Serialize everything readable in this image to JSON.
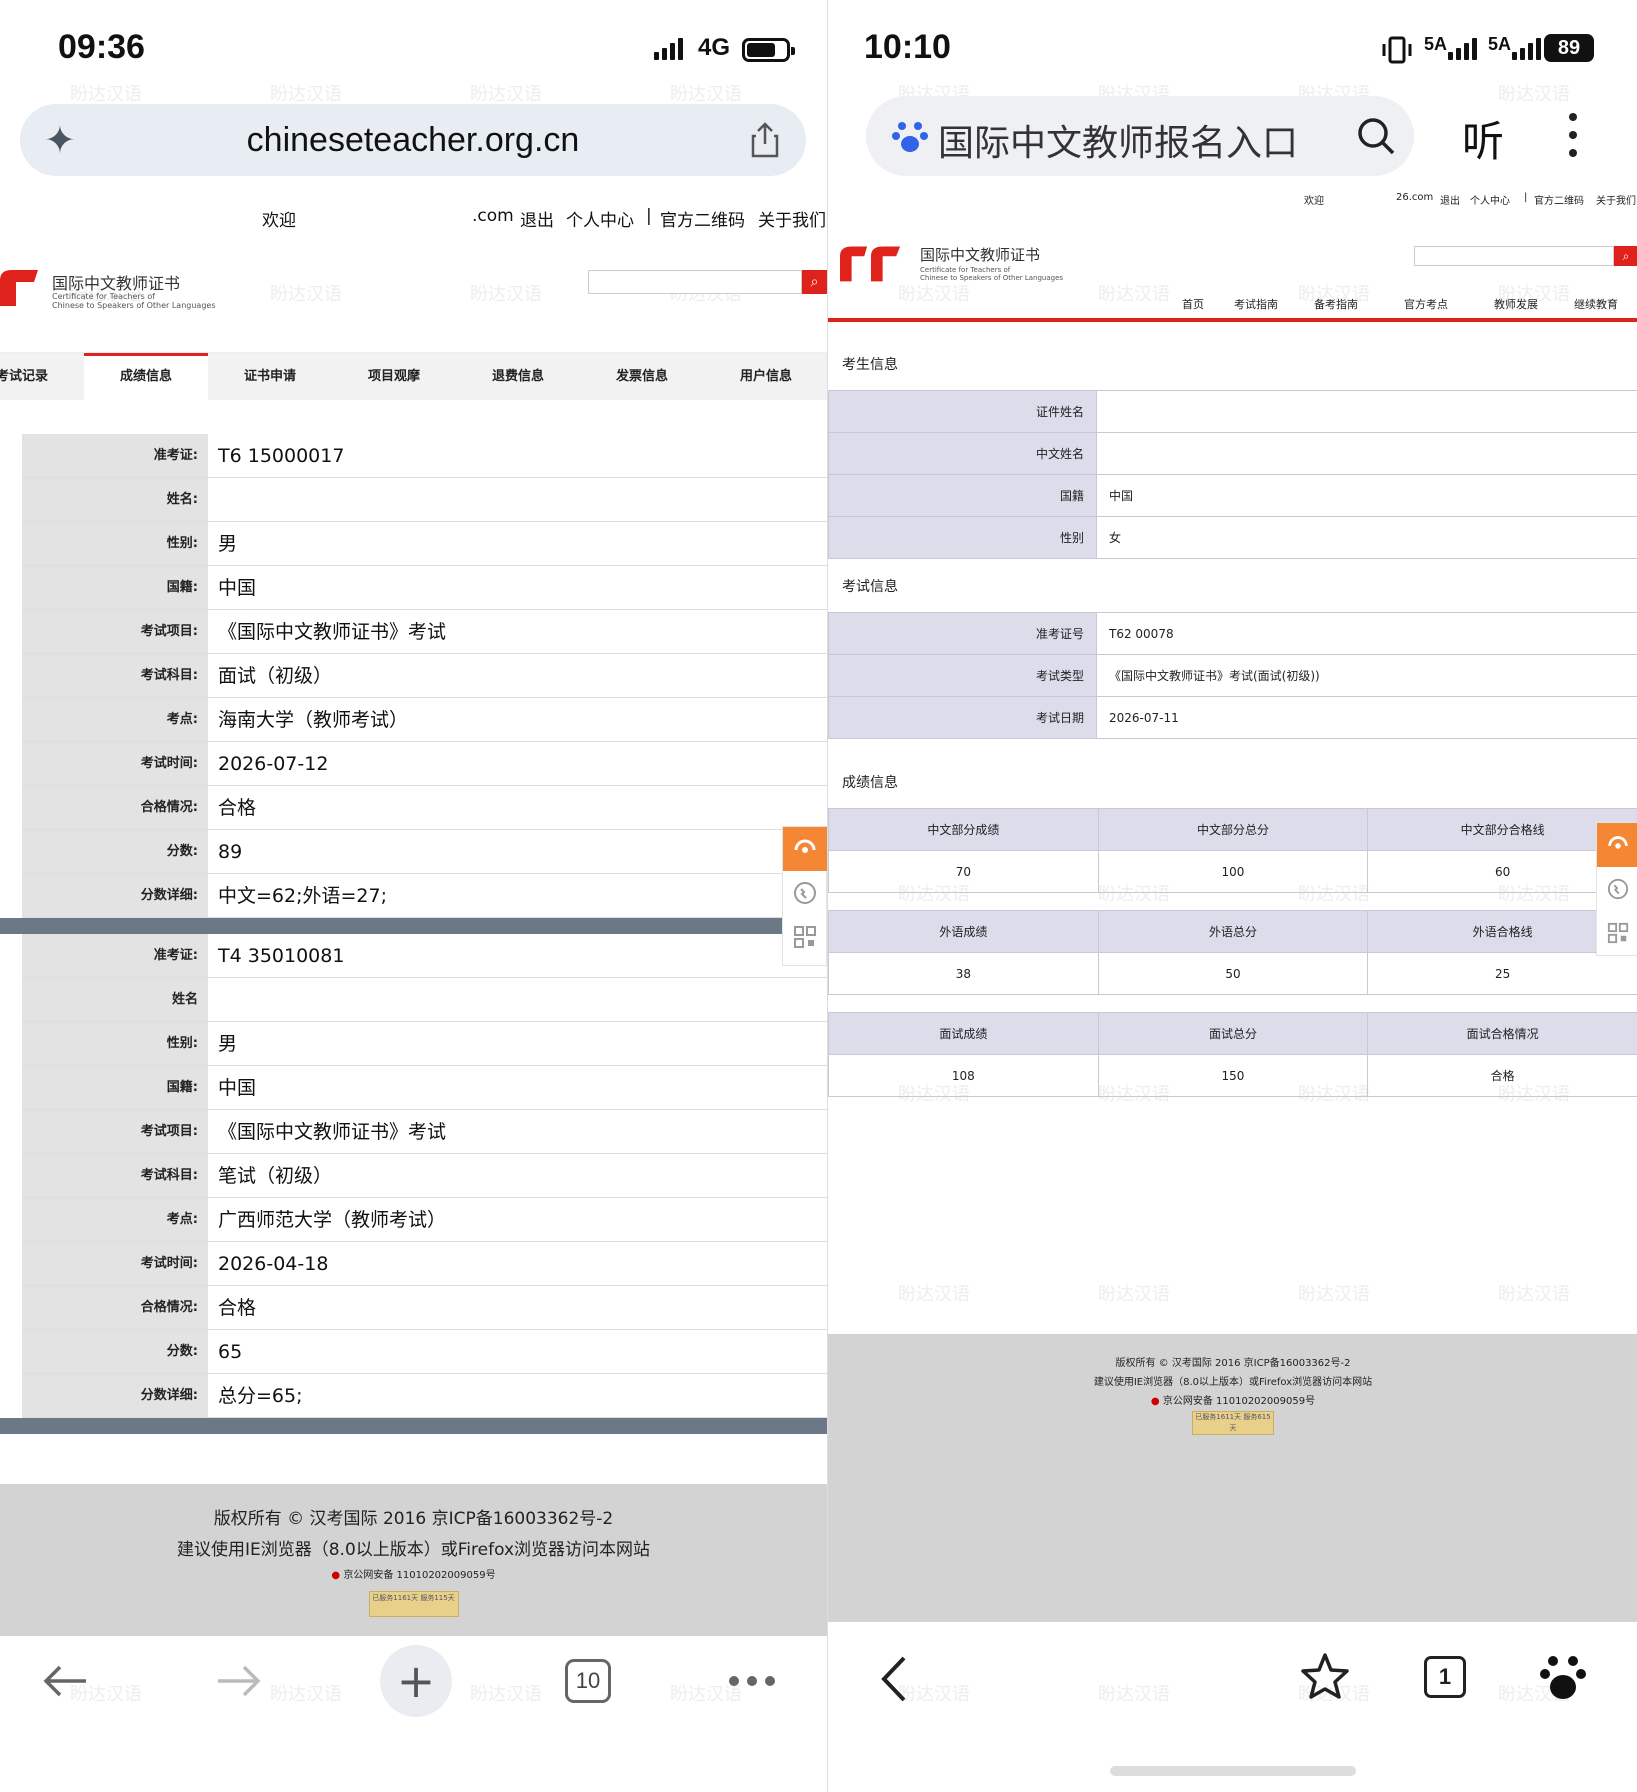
{
  "watermark": "盼达汉语",
  "left": {
    "status": {
      "time": "09:36",
      "network": "4G"
    },
    "browser": {
      "url": "chineseteacher.org.cn",
      "tab_count": "10"
    },
    "site": {
      "topnav": {
        "welcome": "欢迎",
        "email_tail": ".com",
        "logout": "退出",
        "personal": "个人中心",
        "sep": "|",
        "qrcode": "官方二维码",
        "about": "关于我们"
      },
      "logo": {
        "zh": "国际中文教师证书",
        "en1": "Certificate for Teachers of",
        "en2": "Chinese to Speakers of Other Languages"
      },
      "search_icon": "⌕",
      "tabs": [
        "考试记录",
        "成绩信息",
        "证书申请",
        "项目观摩",
        "退费信息",
        "发票信息",
        "用户信息"
      ],
      "records": [
        {
          "rows": [
            {
              "label": "准考证:",
              "value": "T6                 15000017"
            },
            {
              "label": "姓名:",
              "value": ""
            },
            {
              "label": "性别:",
              "value": "男"
            },
            {
              "label": "国籍:",
              "value": "中国"
            },
            {
              "label": "考试项目:",
              "value": "《国际中文教师证书》考试"
            },
            {
              "label": "考试科目:",
              "value": "面试（初级）"
            },
            {
              "label": "考点:",
              "value": "海南大学（教师考试）"
            },
            {
              "label": "考试时间:",
              "value": "2026-07-12"
            },
            {
              "label": "合格情况:",
              "value": "合格"
            },
            {
              "label": "分数:",
              "value": "89"
            },
            {
              "label": "分数详细:",
              "value": "中文=62;外语=27;"
            }
          ]
        },
        {
          "rows": [
            {
              "label": "准考证:",
              "value": "T4                 35010081"
            },
            {
              "label": "姓名",
              "value": ""
            },
            {
              "label": "性别:",
              "value": "男"
            },
            {
              "label": "国籍:",
              "value": "中国"
            },
            {
              "label": "考试项目:",
              "value": "《国际中文教师证书》考试"
            },
            {
              "label": "考试科目:",
              "value": "笔试（初级）"
            },
            {
              "label": "考点:",
              "value": "广西师范大学（教师考试）"
            },
            {
              "label": "考试时间:",
              "value": "2026-04-18"
            },
            {
              "label": "合格情况:",
              "value": "合格"
            },
            {
              "label": "分数:",
              "value": "65"
            },
            {
              "label": "分数详细:",
              "value": "总分=65;"
            }
          ]
        }
      ],
      "footer": {
        "line1": "版权所有 © 汉考国际 2016 京ICP备16003362号-2",
        "line2": "建议使用IE浏览器（8.0以上版本）或Firefox浏览器访问本网站",
        "line3": "京公网安备 11010202009059号",
        "badge": "已服务1161天 服务115天"
      }
    }
  },
  "right": {
    "status": {
      "time": "10:10",
      "net1": "5A",
      "net2": "5A",
      "battery": "89"
    },
    "browser": {
      "query": "国际中文教师报名入口",
      "listen": "听",
      "tab_count": "1"
    },
    "site": {
      "topnav": {
        "welcome": "欢迎",
        "email_tail": "26.com",
        "logout": "退出",
        "personal": "个人中心",
        "sep": "|",
        "qrcode": "官方二维码",
        "about": "关于我们"
      },
      "logo": {
        "zh": "国际中文教师证书",
        "en1": "Certificate for Teachers of",
        "en2": "Chinese to Speakers of Other Languages"
      },
      "nav": [
        "首页",
        "考试指南",
        "备考指南",
        "官方考点",
        "教师发展",
        "继续教育"
      ],
      "candidate": {
        "title": "考生信息",
        "rows": [
          {
            "label": "证件姓名",
            "value": ""
          },
          {
            "label": "中文姓名",
            "value": ""
          },
          {
            "label": "国籍",
            "value": "中国"
          },
          {
            "label": "性别",
            "value": "女"
          }
        ]
      },
      "exam": {
        "title": "考试信息",
        "rows": [
          {
            "label": "准考证号",
            "value": "T62              00078"
          },
          {
            "label": "考试类型",
            "value": "《国际中文教师证书》考试(面试(初级))"
          },
          {
            "label": "考试日期",
            "value": "2026-07-11"
          }
        ]
      },
      "scores": {
        "title": "成绩信息",
        "groups": [
          {
            "headers": [
              "中文部分成绩",
              "中文部分总分",
              "中文部分合格线"
            ],
            "values": [
              "70",
              "100",
              "60"
            ]
          },
          {
            "headers": [
              "外语成绩",
              "外语总分",
              "外语合格线"
            ],
            "values": [
              "38",
              "50",
              "25"
            ]
          },
          {
            "headers": [
              "面试成绩",
              "面试总分",
              "面试合格情况"
            ],
            "values": [
              "108",
              "150",
              "合格"
            ]
          }
        ]
      },
      "footer": {
        "line1": "版权所有 © 汉考国际 2016 京ICP备16003362号-2",
        "line2": "建议使用IE浏览器（8.0以上版本）或Firefox浏览器访问本网站",
        "line3": "京公网安备 11010202009059号",
        "badge": "已服务1611天 服务615天"
      }
    }
  },
  "colors": {
    "brand_red": "#e0221c",
    "service_orange": "#f58634",
    "label_bg": "#dcdcea",
    "separator": "#6d7887"
  }
}
